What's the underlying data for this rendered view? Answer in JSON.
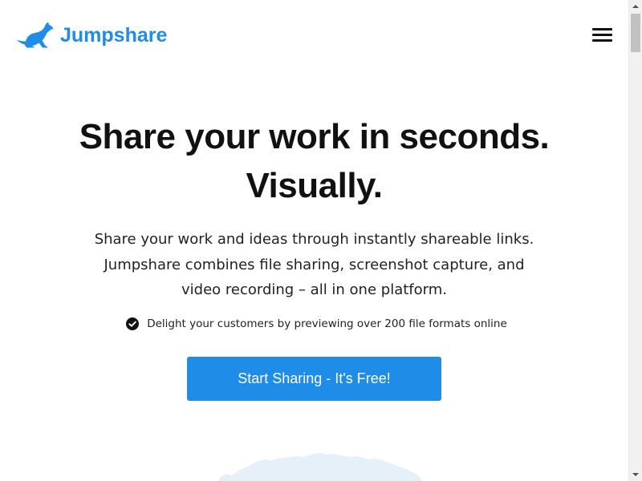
{
  "header": {
    "logo_text": "Jumpshare",
    "logo_icon": "kangaroo-icon",
    "menu_icon": "hamburger-menu-icon"
  },
  "hero": {
    "title_line1": "Share your work in seconds.",
    "title_line2": "Visually.",
    "description_lines": [
      "Share your work and ideas through instantly shareable links.",
      "Jumpshare combines file sharing, screenshot capture, and",
      "video recording – all in one platform."
    ],
    "feature": {
      "icon": "check-circle-icon",
      "text": "Delight your customers by previewing over 200 file formats online"
    },
    "cta_label": "Start Sharing - It's Free!"
  },
  "colors": {
    "brand_blue": "#1f8ce8",
    "title_text": "#111111",
    "body_text": "#222222",
    "illustration": "#e6f0f8"
  },
  "scrollbar": {
    "up_icon": "scroll-up-arrow-icon",
    "down_icon": "scroll-down-arrow-icon"
  }
}
